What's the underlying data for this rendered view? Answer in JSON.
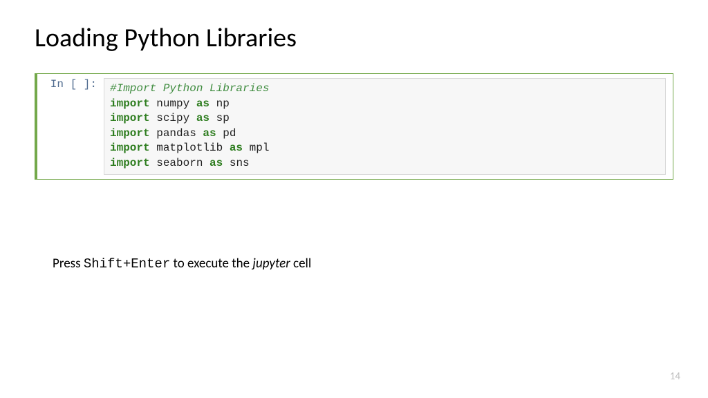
{
  "title": "Loading Python Libraries",
  "cell": {
    "prompt": "In [ ]:",
    "lines": [
      {
        "comment": "#Import Python Libraries"
      },
      {
        "kw1": "import",
        "mod": " numpy ",
        "kw2": "as",
        "alias": " np"
      },
      {
        "kw1": "import",
        "mod": " scipy ",
        "kw2": "as",
        "alias": " sp"
      },
      {
        "kw1": "import",
        "mod": " pandas ",
        "kw2": "as",
        "alias": " pd"
      },
      {
        "kw1": "import",
        "mod": " matplotlib ",
        "kw2": "as",
        "alias": " mpl"
      },
      {
        "kw1": "import",
        "mod": " seaborn ",
        "kw2": "as",
        "alias": " sns"
      }
    ]
  },
  "caption": {
    "pre": "Press ",
    "key": "Shift+Enter",
    "mid": " to execute the ",
    "em": "jupyter",
    "post": " cell"
  },
  "page_number": "14"
}
